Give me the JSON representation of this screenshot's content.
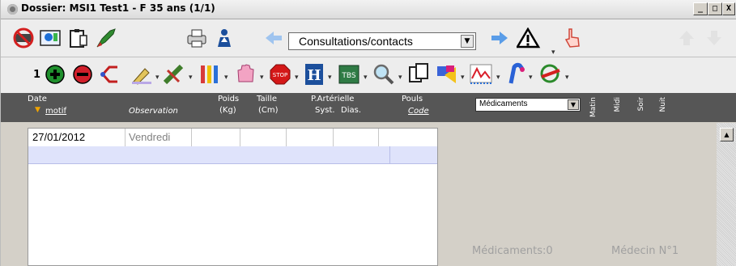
{
  "window": {
    "title": "Dossier: MSI1 Test1 - F 35 ans (1/1)",
    "buttons": {
      "minimize": "_",
      "maximize": "□",
      "close": "X"
    }
  },
  "toolbar1": {
    "combo_value": "Consultations/contacts",
    "icons": [
      "no-smoking-icon",
      "patient-card-icon",
      "clipboard-icon",
      "rocket-icon",
      "printer-icon",
      "person-upload-icon",
      "back-arrow-icon",
      "forward-arrow-icon",
      "warning-icon",
      "hand-pointer-icon",
      "up-arrow-disabled-icon",
      "down-arrow-disabled-icon"
    ]
  },
  "toolbar2": {
    "counter": "1",
    "icons": [
      "add-green-icon",
      "remove-red-icon",
      "share-arrow-icon",
      "pen-edit-icon",
      "syringe-icon",
      "test-tubes-icon",
      "hand-icon",
      "stop-sign-icon",
      "hospital-h-icon",
      "tbs-icon",
      "magnifier-icon",
      "copy-documents-icon",
      "shapes-icon",
      "chart-line-icon",
      "phone-pipe-icon",
      "stethoscope-icon"
    ]
  },
  "columns": {
    "date": "Date",
    "motif": "motif",
    "observation": "Observation",
    "poids_1": "Poids",
    "poids_2": "(Kg)",
    "taille_1": "Taille",
    "taille_2": "(Cm)",
    "pa_1": "P.Artérielle",
    "pa_syst": "Syst.",
    "pa_dias": "Dias.",
    "pouls": "Pouls",
    "code": "Code",
    "medicaments_select": "Médicaments",
    "matin": "Matin",
    "midi": "Midi",
    "soir": "Soir",
    "nuit": "Nuit"
  },
  "consultation": {
    "date": "27/01/2012",
    "day": "Vendredi"
  },
  "status": {
    "medicaments": "Médicaments:0",
    "medecin": "Médecin N°1"
  },
  "colors": {
    "header_bg": "#565656",
    "selected_row": "#dfe3fb",
    "toolbar_bg": "#ededed"
  }
}
